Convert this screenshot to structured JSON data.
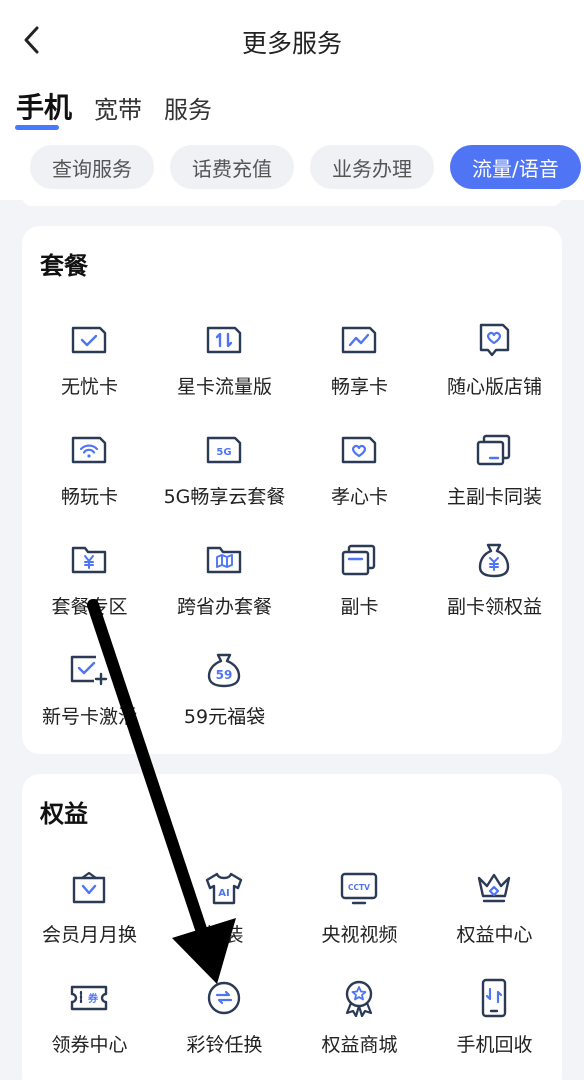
{
  "header": {
    "title": "更多服务",
    "back_icon": "chevron-left-icon"
  },
  "main_tabs": [
    {
      "label": "手机",
      "active": true
    },
    {
      "label": "宽带",
      "active": false
    },
    {
      "label": "服务",
      "active": false
    }
  ],
  "sub_tabs": [
    {
      "label": "查询服务",
      "active": false
    },
    {
      "label": "话费充值",
      "active": false
    },
    {
      "label": "业务办理",
      "active": false
    },
    {
      "label": "流量/语音",
      "active": true
    }
  ],
  "colors": {
    "accent": "#4f75f5",
    "icon_stroke": "#2b3a55",
    "background": "#f3f4f8"
  },
  "sections": [
    {
      "title": "套餐",
      "items": [
        {
          "label": "无忧卡",
          "icon": "card-check-icon"
        },
        {
          "label": "星卡流量版",
          "icon": "card-data-icon"
        },
        {
          "label": "畅享卡",
          "icon": "card-chart-icon"
        },
        {
          "label": "随心版店铺",
          "icon": "card-heart-icon"
        },
        {
          "label": "畅玩卡",
          "icon": "card-wifi-icon"
        },
        {
          "label": "5G畅享云套餐",
          "icon": "card-5g-icon"
        },
        {
          "label": "孝心卡",
          "icon": "card-heart-icon"
        },
        {
          "label": "主副卡同装",
          "icon": "dual-card-icon"
        },
        {
          "label": "套餐专区",
          "icon": "folder-yuan-icon"
        },
        {
          "label": "跨省办套餐",
          "icon": "folder-map-icon"
        },
        {
          "label": "副卡",
          "icon": "dual-card-icon"
        },
        {
          "label": "副卡领权益",
          "icon": "money-bag-icon"
        },
        {
          "label": "新号卡激活",
          "icon": "card-activate-icon"
        },
        {
          "label": "59元福袋",
          "icon": "lucky-bag-icon",
          "badge": "59"
        }
      ]
    },
    {
      "title": "权益",
      "items": [
        {
          "label": "会员月月换",
          "icon": "gift-box-icon"
        },
        {
          "label": "换装",
          "icon": "shirt-icon",
          "badge": "AI"
        },
        {
          "label": "央视视频",
          "icon": "tv-icon",
          "badge": "CCTV"
        },
        {
          "label": "权益中心",
          "icon": "crown-icon"
        },
        {
          "label": "领券中心",
          "icon": "coupon-icon",
          "badge": "券"
        },
        {
          "label": "彩铃任换",
          "icon": "ringtone-icon"
        },
        {
          "label": "权益商城",
          "icon": "award-icon"
        },
        {
          "label": "手机回收",
          "icon": "phone-recycle-icon"
        }
      ]
    }
  ]
}
